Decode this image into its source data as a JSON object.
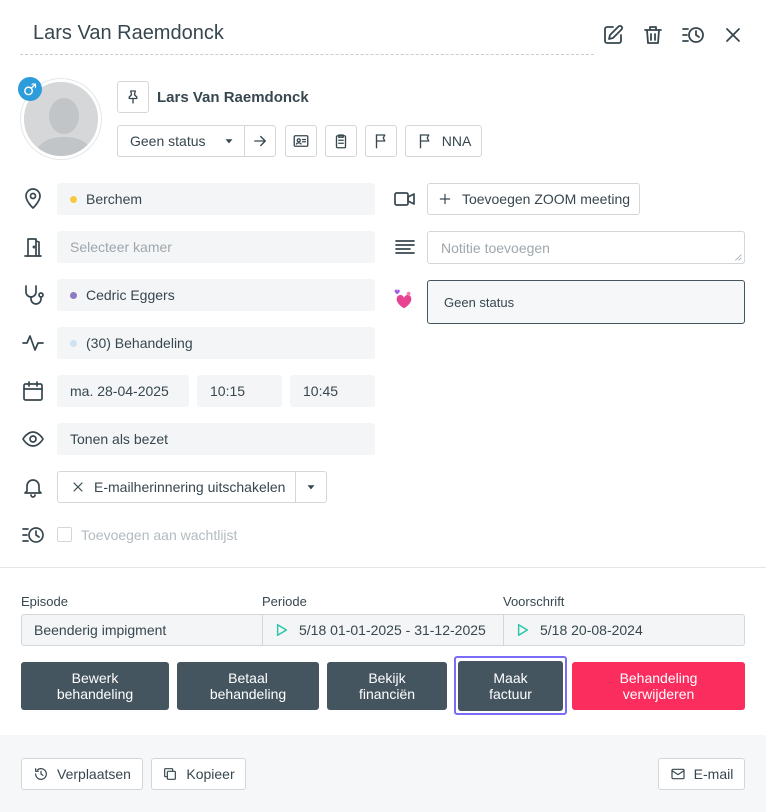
{
  "header": {
    "title": "Lars Van Raemdonck"
  },
  "patient": {
    "name": "Lars Van Raemdonck",
    "gender_symbol": "♂",
    "status_label": "Geen status",
    "nna_label": "NNA"
  },
  "fields": {
    "location": {
      "value": "Berchem",
      "dot_color": "#f6c945"
    },
    "room": {
      "placeholder": "Selecteer kamer"
    },
    "therapist": {
      "value": "Cedric Eggers",
      "dot_color": "#8e7cc3"
    },
    "treatment": {
      "value": "(30) Behandeling",
      "dot_color": "#cfe2f3"
    },
    "date": {
      "value": "ma. 28-04-2025"
    },
    "start_time": {
      "value": "10:15"
    },
    "end_time": {
      "value": "10:45"
    },
    "visibility": {
      "value": "Tonen als bezet"
    },
    "reminder": {
      "label": "E-mailherinnering uitschakelen"
    },
    "waitlist": {
      "label": "Toevoegen aan wachtlijst"
    }
  },
  "right": {
    "zoom_label": "Toevoegen ZOOM meeting",
    "note_placeholder": "Notitie toevoegen",
    "status_value": "Geen status"
  },
  "episode_section": {
    "episode_label": "Episode",
    "episode_value": "Beenderig impigment",
    "period_label": "Periode",
    "period_value": "5/18 01-01-2025 - 31-12-2025",
    "prescription_label": "Voorschrift",
    "prescription_value": "5/18 20-08-2024"
  },
  "actions": {
    "edit": "Bewerk behandeling",
    "pay": "Betaal behandeling",
    "finance": "Bekijk financiën",
    "invoice": "Maak factuur",
    "delete": "Behandeling verwijderen"
  },
  "footer": {
    "move": "Verplaatsen",
    "copy": "Kopieer",
    "email": "E-mail"
  },
  "colors": {
    "dark_button": "#455560",
    "danger": "#fb2c5e",
    "accent_outline": "#7b6cf6",
    "play_icon": "#26c6a6",
    "gender_badge": "#2d9cdb"
  }
}
